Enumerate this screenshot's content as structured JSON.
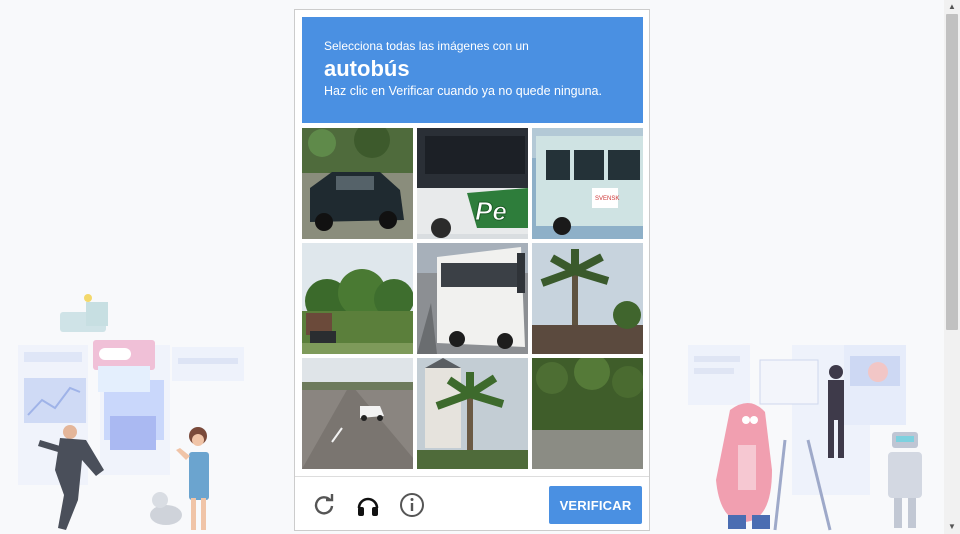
{
  "captcha": {
    "instruction_line1": "Selecciona todas las imágenes con un",
    "target_object": "autobús",
    "instruction_line2": "Haz clic en Verificar cuando ya no quede ninguna.",
    "header_color": "#4a90e2",
    "tiles": [
      {
        "name": "tile-1",
        "content": "car"
      },
      {
        "name": "tile-2",
        "content": "bus"
      },
      {
        "name": "tile-3",
        "content": "bus"
      },
      {
        "name": "tile-4",
        "content": "trees"
      },
      {
        "name": "tile-5",
        "content": "bus"
      },
      {
        "name": "tile-6",
        "content": "palm-tree"
      },
      {
        "name": "tile-7",
        "content": "road"
      },
      {
        "name": "tile-8",
        "content": "palm-tree"
      },
      {
        "name": "tile-9",
        "content": "hedge"
      }
    ],
    "controls": {
      "reload_icon": "reload-icon",
      "audio_icon": "headphones-icon",
      "info_icon": "info-icon"
    },
    "verify_label": "VERIFICAR"
  }
}
